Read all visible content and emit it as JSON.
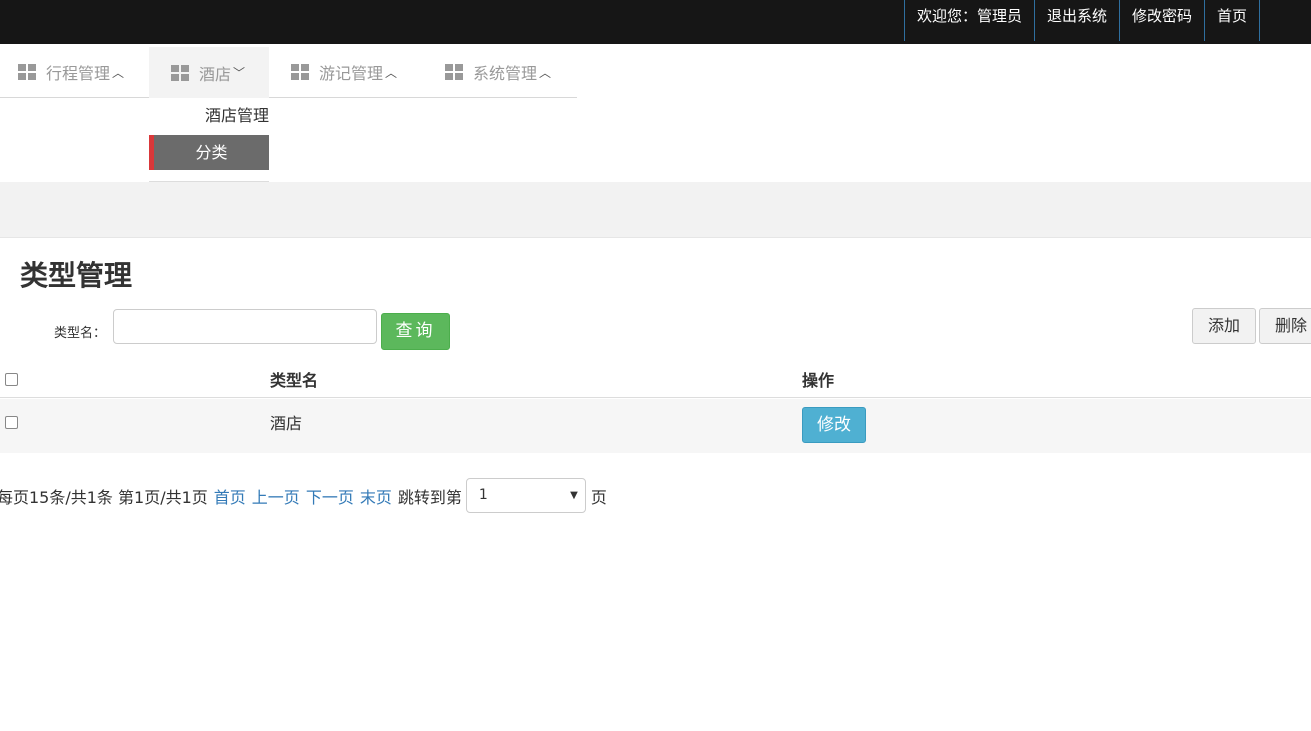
{
  "topbar": {
    "welcome": "欢迎您：管理员",
    "logout": "退出系统",
    "change_password": "修改密码",
    "home": "首页"
  },
  "nav": {
    "items": [
      {
        "label": "行程管理",
        "chevron": "^"
      },
      {
        "label": "酒店",
        "chevron": "v"
      },
      {
        "label": "游记管理",
        "chevron": "^"
      },
      {
        "label": "系统管理",
        "chevron": "^"
      }
    ],
    "dropdown": [
      "酒店管理",
      "分类"
    ]
  },
  "page": {
    "title": "类型管理"
  },
  "search": {
    "label": "类型名：",
    "value": "",
    "query_button": "查询"
  },
  "actions": {
    "add": "添加",
    "delete": "删除"
  },
  "table": {
    "columns": [
      "类型名",
      "操作"
    ],
    "rows": [
      {
        "name": "酒店",
        "edit_button": "修改"
      }
    ]
  },
  "pagination": {
    "summary": "每页15条/共1条 第1页/共1页",
    "first": "首页",
    "prev": "上一页",
    "next": "下一页",
    "last": "末页",
    "jump_label": "跳转到第",
    "current_page": "1",
    "suffix": "页"
  },
  "colors": {
    "topbar_bg": "#161616",
    "query_button": "#5cb85c",
    "edit_button": "#4fb0d2",
    "active_marker": "#d9383a",
    "link": "#337ab7"
  }
}
